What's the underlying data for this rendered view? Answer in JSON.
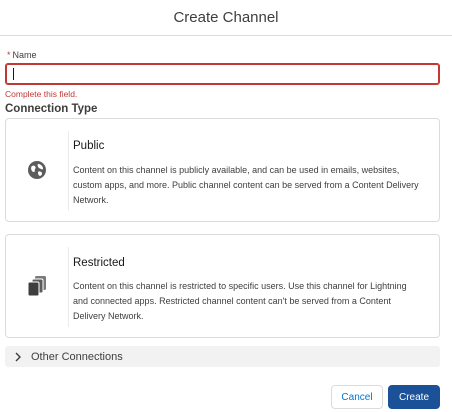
{
  "modal": {
    "title": "Create Channel"
  },
  "name_field": {
    "required_mark": "*",
    "label": "Name",
    "value": "",
    "error": "Complete this field."
  },
  "connection_type": {
    "heading": "Connection Type",
    "options": [
      {
        "title": "Public",
        "icon": "globe-icon",
        "description": "Content on this channel is publicly available, and can be used in emails, websites, custom apps, and more. Public channel content can be served from a Content Delivery Network."
      },
      {
        "title": "Restricted",
        "icon": "stacked-copy-icon",
        "description": "Content on this channel is restricted to specific users. Use this channel for Lightning and connected apps. Restricted channel content can't be served from a Content Delivery Network."
      }
    ]
  },
  "other_connections": {
    "label": "Other Connections",
    "icon": "chevron-right-icon"
  },
  "footer": {
    "cancel_label": "Cancel",
    "create_label": "Create"
  },
  "colors": {
    "error": "#c23934",
    "brand": "#1b5297",
    "link": "#0176d3",
    "border": "#dddbda"
  }
}
